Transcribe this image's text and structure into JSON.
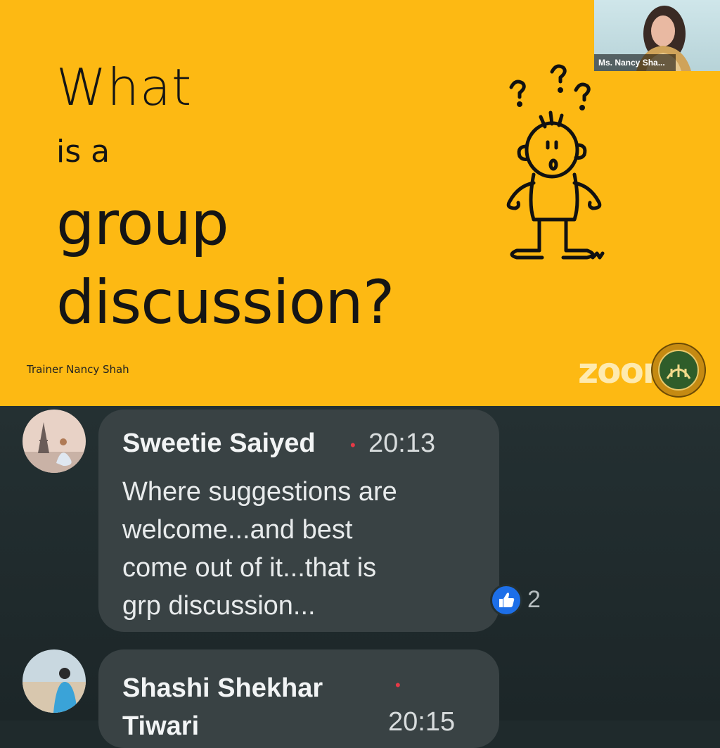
{
  "slide": {
    "line1": "What",
    "line2": "is a",
    "line3": "group",
    "line4": "discussion?",
    "trainer": "Trainer Nancy Shah",
    "watermark": "zoom",
    "background": "#fdb913",
    "cartoon_icon": "confused-stick-figure"
  },
  "video_tile": {
    "participant_name": "Ms. Nancy Sha..."
  },
  "comments": [
    {
      "author": "Sweetie Saiyed",
      "time": "20:13",
      "text": "Where suggestions are welcome...and best come out of it...that is grp discussion...",
      "text_lines": [
        "Where suggestions are",
        "welcome...and best",
        "come out of it...that is",
        "grp discussion..."
      ],
      "reaction_icon": "like-icon",
      "reaction_count": "2"
    },
    {
      "author": "Shashi Shekhar Tiwari",
      "author_lines": [
        "Shashi Shekhar",
        "Tiwari"
      ],
      "time": "20:15"
    }
  ]
}
